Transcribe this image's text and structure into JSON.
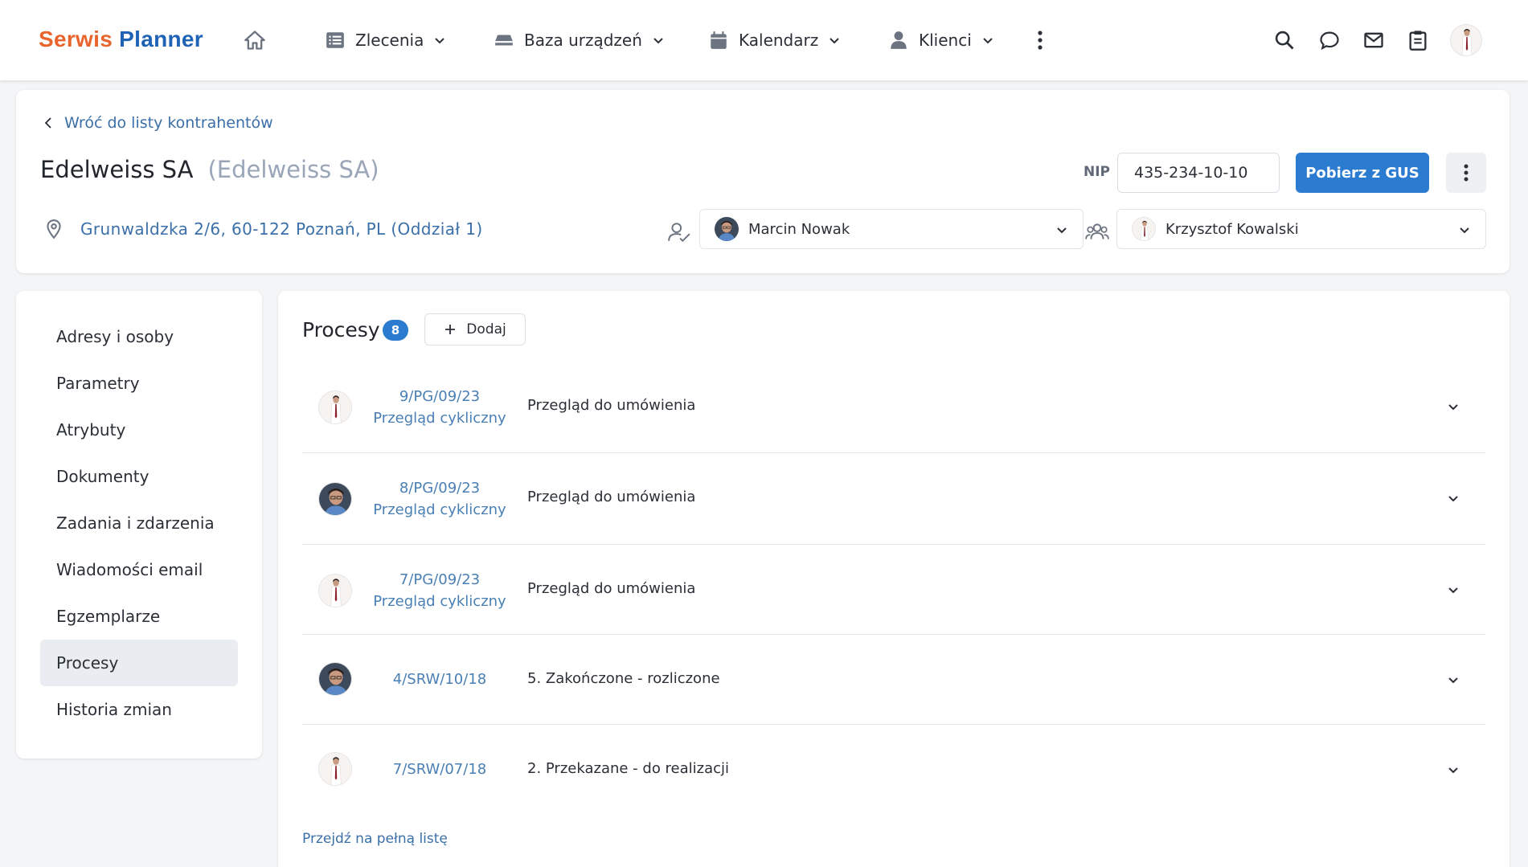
{
  "app": {
    "logo_part1": "Serwis",
    "logo_part2": "Planner"
  },
  "nav": {
    "items": [
      {
        "label": "Zlecenia",
        "icon": "list-icon"
      },
      {
        "label": "Baza urządzeń",
        "icon": "device-icon"
      },
      {
        "label": "Kalendarz",
        "icon": "calendar-icon"
      },
      {
        "label": "Klienci",
        "icon": "person-icon"
      }
    ],
    "top_icons": [
      "search-icon",
      "chat-icon",
      "mail-icon",
      "clipboard-icon"
    ]
  },
  "header": {
    "back_link": "Wróć do listy kontrahentów",
    "company_name": "Edelweiss SA",
    "company_alias": "(Edelweiss SA)",
    "nip_label": "NIP",
    "nip_value": "435-234-10-10",
    "gus_button": "Pobierz z GUS",
    "address": "Grunwaldzka 2/6, 60-122 Poznań, PL (Oddział 1)",
    "assignee": "Marcin Nowak",
    "team_member": "Krzysztof Kowalski"
  },
  "sidebar": {
    "items": [
      {
        "label": "Adresy i osoby"
      },
      {
        "label": "Parametry"
      },
      {
        "label": "Atrybuty"
      },
      {
        "label": "Dokumenty"
      },
      {
        "label": "Zadania i zdarzenia"
      },
      {
        "label": "Wiadomości email"
      },
      {
        "label": "Egzemplarze"
      },
      {
        "label": "Procesy",
        "active": true
      },
      {
        "label": "Historia zmian"
      }
    ]
  },
  "processes": {
    "title": "Procesy",
    "count": "8",
    "add_button": "Dodaj",
    "rows": [
      {
        "number": "9/PG/09/23",
        "type": "Przegląd cykliczny",
        "status": "Przegląd do umówienia",
        "avatar": "b"
      },
      {
        "number": "8/PG/09/23",
        "type": "Przegląd cykliczny",
        "status": "Przegląd do umówienia",
        "avatar": "a"
      },
      {
        "number": "7/PG/09/23",
        "type": "Przegląd cykliczny",
        "status": "Przegląd do umówienia",
        "avatar": "b"
      },
      {
        "number": "4/SRW/10/18",
        "type": "",
        "status": "5. Zakończone - rozliczone",
        "avatar": "a"
      },
      {
        "number": "7/SRW/07/18",
        "type": "",
        "status": "2. Przekazane - do realizacji",
        "avatar": "b"
      }
    ],
    "full_list_link": "Przejdź na pełną listę"
  },
  "colors": {
    "accent": "#2b7bd1",
    "link": "#3b6fa8",
    "logo_orange": "#e8642c",
    "logo_blue": "#1f63b5"
  }
}
